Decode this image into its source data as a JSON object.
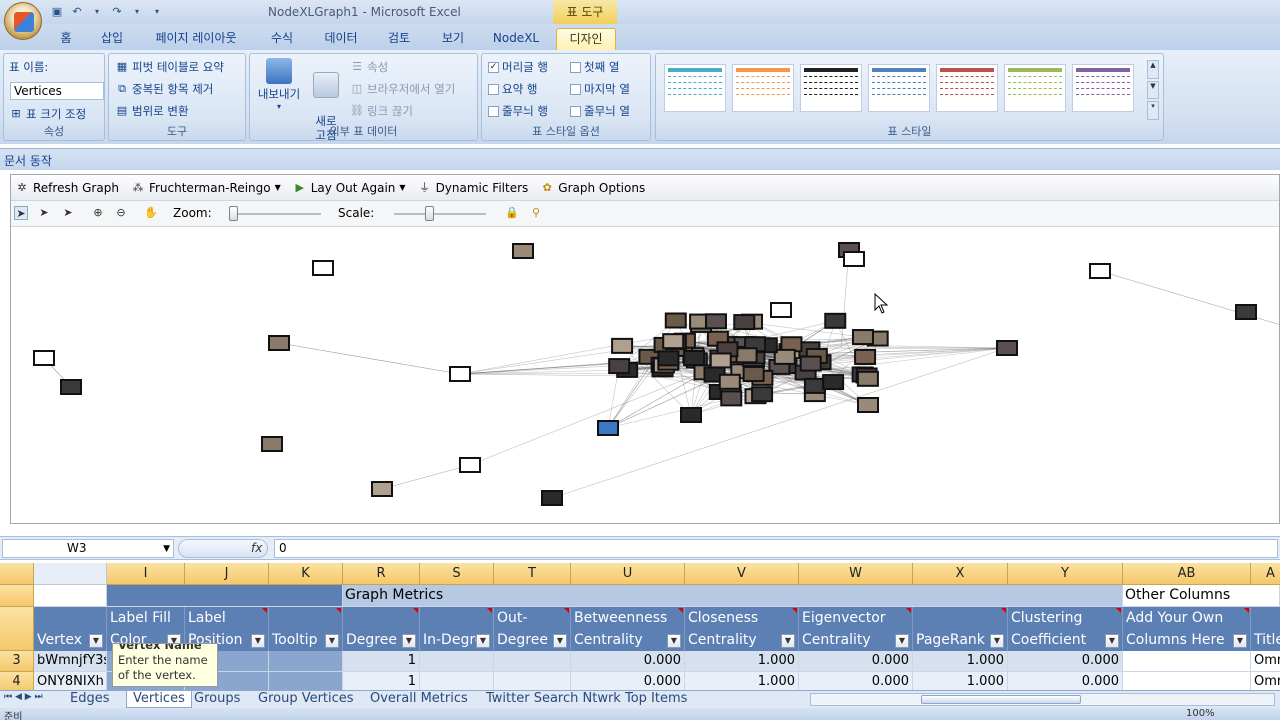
{
  "window": {
    "title": "NodeXLGraph1 - Microsoft Excel",
    "context_tab_title": "표 도구"
  },
  "ribbon_tabs": [
    "홈",
    "삽입",
    "페이지 레이아웃",
    "수식",
    "데이터",
    "검토",
    "보기",
    "NodeXL",
    "디자인"
  ],
  "ribbon": {
    "properties": {
      "table_name_label": "표 이름:",
      "table_name_value": "Vertices",
      "resize_label": "표 크기 조정",
      "group_label": "속성"
    },
    "tools": {
      "pivot": "피벗 테이블로 요약",
      "remove_dup": "중복된 항목 제거",
      "convert_range": "범위로 변환",
      "group_label": "도구"
    },
    "external": {
      "export": "내보내기",
      "refresh": "새로\n고침",
      "properties": "속성",
      "open_browser": "브라우저에서 열기",
      "unlink": "링크 끊기",
      "group_label": "외부 표 데이터"
    },
    "style_options": {
      "header_row": "머리글 행",
      "first_col": "첫째 열",
      "total_row": "요약 행",
      "last_col": "마지막 열",
      "banded_rows": "줄무늬 행",
      "banded_cols": "줄무늬 열",
      "header_row_checked": true,
      "group_label": "표 스타일 옵션"
    },
    "table_styles": {
      "group_label": "표 스타일",
      "swatch_colors": [
        "#4bacc6",
        "#f79646",
        "#222222",
        "#4f81bd",
        "#c0504d",
        "#9bbb59",
        "#8064a2"
      ]
    }
  },
  "doc_actions_label": "문서 동작",
  "nodexl_toolbar": {
    "refresh": "Refresh Graph",
    "layout": "Fruchterman-Reingo",
    "layout_again": "Lay Out Again",
    "filters": "Dynamic Filters",
    "options": "Graph Options",
    "zoom_label": "Zoom:",
    "scale_label": "Scale:",
    "zoom_level": 0.0,
    "scale_level": 0.35
  },
  "formula_bar": {
    "cell_ref": "W3",
    "fx": "fx",
    "value": "0"
  },
  "grid": {
    "columns": [
      "I",
      "J",
      "K",
      "R",
      "S",
      "T",
      "U",
      "V",
      "W",
      "X",
      "Y",
      "AB",
      "A"
    ],
    "group_header_graph_metrics": "Graph Metrics",
    "group_header_other": "Other Columns",
    "header_labels": {
      "vertex": "Vertex",
      "label_fill": "Label Fill\nColor",
      "label_pos": "Label\nPosition",
      "tooltip": "Tooltip",
      "degree": "Degree",
      "in_degree": "In-Degre",
      "out_degree": "Out-\nDegree",
      "betweenness": "Betweenness\nCentrality",
      "closeness": "Closeness\nCentrality",
      "eigenvector": "Eigenvector\nCentrality",
      "pagerank": "PageRank",
      "clustering": "Clustering\nCoefficient",
      "own_cols": "Add Your Own\nColumns Here",
      "title": "Title"
    },
    "rows": [
      {
        "num": "3",
        "vertex": "bWmnjfY3s",
        "degree": "1",
        "betweenness": "0.000",
        "closeness": "1.000",
        "eigenvector": "0.000",
        "pagerank": "1.000",
        "clustering": "0.000",
        "title": "Omr"
      },
      {
        "num": "4",
        "vertex": "ONY8NIXh",
        "degree": "1",
        "betweenness": "0.000",
        "closeness": "1.000",
        "eigenvector": "0.000",
        "pagerank": "1.000",
        "clustering": "0.000",
        "title": "Omr"
      }
    ],
    "tooltip": {
      "title": "Vertex Name",
      "text": "Enter the name of the vertex."
    }
  },
  "sheet_tabs": [
    "Edges",
    "Vertices",
    "Groups",
    "Group Vertices",
    "Overall Metrics",
    "Twitter Search Ntwrk Top Items"
  ],
  "active_sheet": "Vertices",
  "status": {
    "ready": "준비",
    "zoom": "100%"
  }
}
